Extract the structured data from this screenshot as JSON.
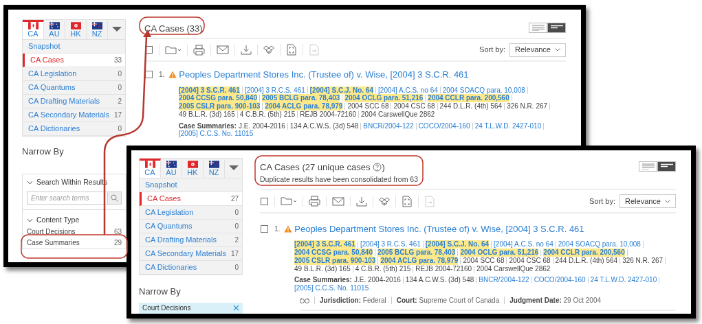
{
  "panels": [
    {
      "tabs": [
        {
          "kind": "region",
          "label": "CA",
          "selected": true
        },
        {
          "kind": "region",
          "label": "AU",
          "selected": false
        },
        {
          "kind": "region",
          "label": "HK",
          "selected": false
        },
        {
          "kind": "region",
          "label": "NZ",
          "selected": false
        },
        {
          "kind": "more",
          "selected": false
        }
      ],
      "nav": [
        {
          "label": "Snapshot",
          "selected": false
        },
        {
          "label": "CA Cases",
          "count": "33",
          "selected": true
        },
        {
          "label": "CA Legislation",
          "count": "0",
          "selected": false
        },
        {
          "label": "CA Quantums",
          "count": "0",
          "selected": false
        },
        {
          "label": "CA Drafting Materials",
          "count": "2",
          "selected": false
        },
        {
          "label": "CA Secondary Materials",
          "count": "17",
          "selected": false
        },
        {
          "label": "CA Dictionaries",
          "count": "0",
          "selected": false
        }
      ],
      "narrow_by": "Narrow By",
      "sections": [
        {
          "kind": "search",
          "title": "Search Within Results",
          "expanded": true,
          "placeholder": "Enter search terms"
        },
        {
          "kind": "facets",
          "title": "Content Type",
          "expanded": true,
          "items": [
            {
              "label": "Court Decisions",
              "count": "63"
            },
            {
              "label": "Case Summaries",
              "count": "29"
            }
          ]
        }
      ],
      "title": "CA Cases (33)",
      "views": [
        {
          "selected": false
        },
        {
          "selected": true
        }
      ],
      "tools": [
        {
          "kind": "checkbox",
          "checked": false,
          "disabled": false
        },
        {
          "kind": "folder",
          "disabled": false
        },
        {
          "kind": "print",
          "disabled": false
        },
        {
          "kind": "email",
          "disabled": false
        },
        {
          "kind": "download",
          "disabled": false
        },
        {
          "kind": "boxes",
          "disabled": false
        },
        {
          "kind": "frame",
          "disabled": false
        },
        {
          "kind": "export",
          "disabled": true
        }
      ],
      "sort_label": "Sort by:",
      "sort_value": "Relevance",
      "result": {
        "checked": false,
        "number": "1.",
        "title": "Peoples Department Stores Inc. (Trustee of) v. Wise, [2004] 3 S.C.R. 461",
        "citations": [
          {
            "text": "[2004] 3 S.C.R. 461",
            "highlighted": true,
            "linked": true
          },
          {
            "text": "[2004] 3 R.C.S. 461",
            "highlighted": false,
            "linked": true
          },
          {
            "text": "[2004] S.C.J. No. 64",
            "highlighted": true,
            "linked": true
          },
          {
            "text": "[2004] A.C.S. no 64",
            "highlighted": false,
            "linked": true
          },
          {
            "text": "2004 SOACQ para. 10,008",
            "highlighted": false,
            "linked": true
          },
          {
            "text": "2004 CCSG para. 50,840",
            "highlighted": true,
            "linked": true
          },
          {
            "text": "2005 BCLG para. 78,403",
            "highlighted": true,
            "linked": true
          },
          {
            "text": "2004 OCLG para. 51,216",
            "highlighted": true,
            "linked": true
          },
          {
            "text": "2004 CCLR para. 200,560",
            "highlighted": true,
            "linked": true
          },
          {
            "text": "2005 CSLR para. 900-103",
            "highlighted": true,
            "linked": true
          },
          {
            "text": "2004 ACLG para. 78,979",
            "highlighted": true,
            "linked": true
          },
          {
            "text": "2004 SCC 68",
            "highlighted": false,
            "linked": false
          },
          {
            "text": "2004 CSC 68",
            "highlighted": false,
            "linked": false
          },
          {
            "text": "244 D.L.R. (4th) 564",
            "highlighted": false,
            "linked": false
          },
          {
            "text": "326 N.R. 267",
            "highlighted": false,
            "linked": false
          },
          {
            "text": "49 B.L.R. (3d) 165",
            "highlighted": false,
            "linked": false
          },
          {
            "text": "4 C.B.R. (5th) 215",
            "highlighted": false,
            "linked": false
          },
          {
            "text": "REJB 2004-72160",
            "highlighted": false,
            "linked": false
          },
          {
            "text": "2004 CarswellQue 2862",
            "highlighted": false,
            "linked": false
          }
        ],
        "summaries_label": "Case Summaries:",
        "summaries": [
          {
            "text": "J.E. 2004-2016",
            "linked": false
          },
          {
            "text": "134 A.C.W.S. (3d) 548",
            "linked": false
          },
          {
            "text": "BNCR/2004-122",
            "linked": true
          },
          {
            "text": "COCO/2004-160",
            "linked": true
          },
          {
            "text": "24 T.L.W.D. 2427-010",
            "linked": true
          },
          {
            "text": "[2005] C.C.S. No. 11015",
            "linked": true
          }
        ]
      }
    },
    {
      "tabs": [
        {
          "kind": "region",
          "label": "CA",
          "selected": true
        },
        {
          "kind": "region",
          "label": "AU",
          "selected": false
        },
        {
          "kind": "region",
          "label": "HK",
          "selected": false
        },
        {
          "kind": "region",
          "label": "NZ",
          "selected": false
        },
        {
          "kind": "more",
          "selected": false
        }
      ],
      "nav": [
        {
          "label": "Snapshot",
          "selected": false
        },
        {
          "label": "CA Cases",
          "count": "27",
          "selected": true
        },
        {
          "label": "CA Legislation",
          "count": "0",
          "selected": false
        },
        {
          "label": "CA Quantums",
          "count": "0",
          "selected": false
        },
        {
          "label": "CA Drafting Materials",
          "count": "2",
          "selected": false
        },
        {
          "label": "CA Secondary Materials",
          "count": "17",
          "selected": false
        },
        {
          "label": "CA Dictionaries",
          "count": "0",
          "selected": false
        }
      ],
      "narrow_by": "Narrow By",
      "applied_filters": [
        {
          "label": "Court Decisions"
        }
      ],
      "title": "CA Cases (27 unique cases",
      "title_close": ")",
      "subtitle": "Duplicate results have been consolidated from 63",
      "views": [
        {
          "selected": false
        },
        {
          "selected": true
        }
      ],
      "tools": [
        {
          "kind": "checkbox",
          "checked": false,
          "disabled": false
        },
        {
          "kind": "folder",
          "disabled": false
        },
        {
          "kind": "print",
          "disabled": false
        },
        {
          "kind": "email",
          "disabled": false
        },
        {
          "kind": "download",
          "disabled": false
        },
        {
          "kind": "boxes",
          "disabled": false
        },
        {
          "kind": "frame",
          "disabled": false
        },
        {
          "kind": "export",
          "disabled": true
        }
      ],
      "sort_label": "Sort by:",
      "sort_value": "Relevance",
      "result": {
        "checked": false,
        "number": "1.",
        "title": "Peoples Department Stores Inc. (Trustee of) v. Wise, [2004] 3 S.C.R. 461",
        "citations": [
          {
            "text": "[2004] 3 S.C.R. 461",
            "highlighted": true,
            "linked": true
          },
          {
            "text": "[2004] 3 R.C.S. 461",
            "highlighted": false,
            "linked": true
          },
          {
            "text": "[2004] S.C.J. No. 64",
            "highlighted": true,
            "linked": true
          },
          {
            "text": "[2004] A.C.S. no 64",
            "highlighted": false,
            "linked": true
          },
          {
            "text": "2004 SOACQ para. 10,008",
            "highlighted": false,
            "linked": true
          },
          {
            "text": "2004 CCSG para. 50,840",
            "highlighted": true,
            "linked": true
          },
          {
            "text": "2005 BCLG para. 78,403",
            "highlighted": true,
            "linked": true
          },
          {
            "text": "2004 OCLG para. 51,216",
            "highlighted": true,
            "linked": true
          },
          {
            "text": "2004 CCLR para. 200,560",
            "highlighted": true,
            "linked": true
          },
          {
            "text": "2005 CSLR para. 900-103",
            "highlighted": true,
            "linked": true
          },
          {
            "text": "2004 ACLG para. 78,979",
            "highlighted": true,
            "linked": true
          },
          {
            "text": "2004 SCC 68",
            "highlighted": false,
            "linked": false
          },
          {
            "text": "2004 CSC 68",
            "highlighted": false,
            "linked": false
          },
          {
            "text": "244 D.L.R. (4th) 564",
            "highlighted": false,
            "linked": false
          },
          {
            "text": "326 N.R. 267",
            "highlighted": false,
            "linked": false
          },
          {
            "text": "49 B.L.R. (3d) 165",
            "highlighted": false,
            "linked": false
          },
          {
            "text": "4 C.B.R. (5th) 215",
            "highlighted": false,
            "linked": false
          },
          {
            "text": "REJB 2004-72160",
            "highlighted": false,
            "linked": false
          },
          {
            "text": "2004 CarswellQue 2862",
            "highlighted": false,
            "linked": false
          }
        ],
        "summaries_label": "Case Summaries:",
        "summaries": [
          {
            "text": "J.E. 2004-2016",
            "linked": false
          },
          {
            "text": "134 A.C.W.S. (3d) 548",
            "linked": false
          },
          {
            "text": "BNCR/2004-122",
            "linked": true
          },
          {
            "text": "COCO/2004-160",
            "linked": true
          },
          {
            "text": "24 T.L.W.D. 2427-010",
            "linked": true
          },
          {
            "text": "[2005] C.C.S. No. 11015",
            "linked": true
          }
        ],
        "meta": [
          {
            "label": "Jurisdiction:",
            "value": "Federal"
          },
          {
            "label": "Court:",
            "value": "Supreme Court of Canada"
          },
          {
            "label": "Judgment Date:",
            "value": "29 Oct 2004"
          }
        ]
      }
    }
  ]
}
